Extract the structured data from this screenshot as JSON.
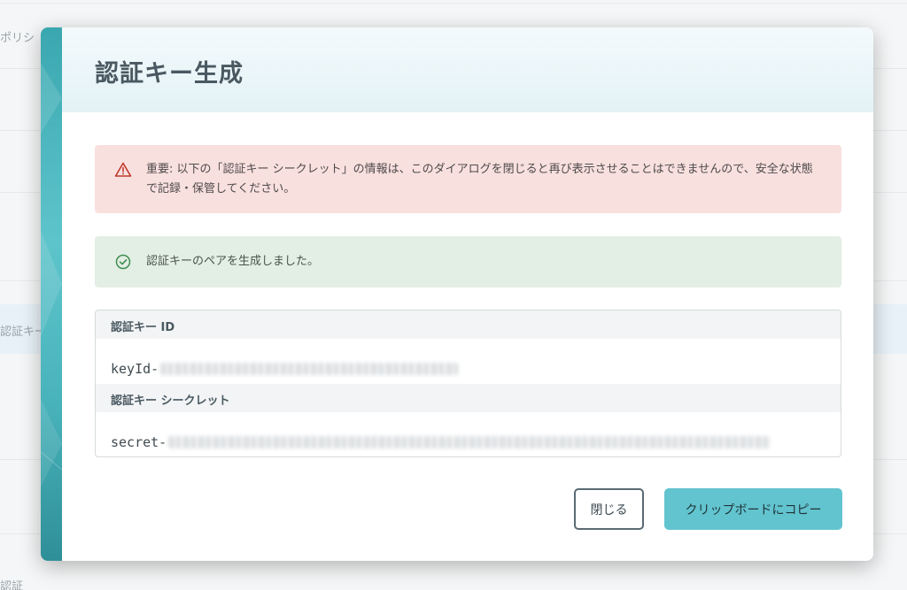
{
  "background": {
    "text_top": "ポリシ",
    "text_mid": "認証キー",
    "text_bottom": "認証"
  },
  "modal": {
    "title": "認証キー生成",
    "alert_danger": {
      "icon": "warning-triangle-icon",
      "text": "重要: 以下の「認証キー シークレット」の情報は、このダイアログを閉じると再び表示させることはできませんので、安全な状態で記録・保管してください。"
    },
    "alert_success": {
      "icon": "check-circle-icon",
      "text": "認証キーのペアを生成しました。"
    },
    "keys": {
      "id_label": "認証キー ID",
      "id_prefix": "keyId-",
      "secret_label": "認証キー シークレット",
      "secret_prefix": "secret-"
    },
    "buttons": {
      "close": "閉じる",
      "copy": "クリップボードにコピー"
    }
  },
  "colors": {
    "accent": "#62c4cf",
    "danger_bg": "#f8e0df",
    "success_bg": "#e3eee4",
    "danger_icon": "#c0392b",
    "success_icon": "#3e8e51"
  }
}
